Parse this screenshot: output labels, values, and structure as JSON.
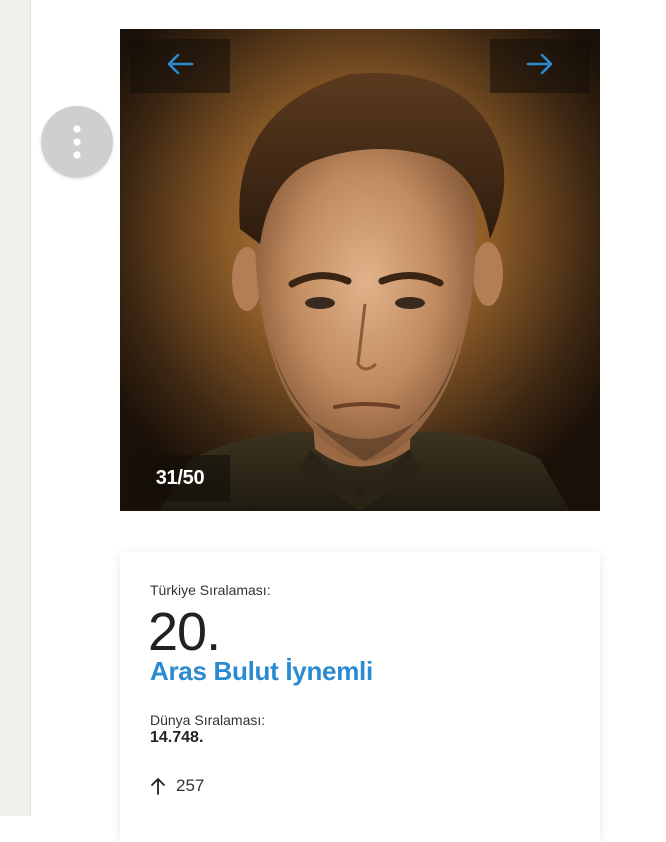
{
  "gallery": {
    "counter": "31/50",
    "prev_icon": "arrow-left-icon",
    "next_icon": "arrow-right-icon",
    "image": "portrait-photo"
  },
  "menu": {
    "icon": "more-vertical-icon"
  },
  "ranking": {
    "turkey_label": "Türkiye Sıralaması:",
    "turkey_rank": "20.",
    "name": "Aras Bulut İynemli",
    "world_label": "Dünya Sıralaması:",
    "world_rank": "14.748.",
    "change_icon": "arrow-up-icon",
    "change_value": "257"
  },
  "colors": {
    "accent": "#2a8bd2",
    "rail": "#f1f0ed",
    "menu_button": "#cfcfcf"
  }
}
